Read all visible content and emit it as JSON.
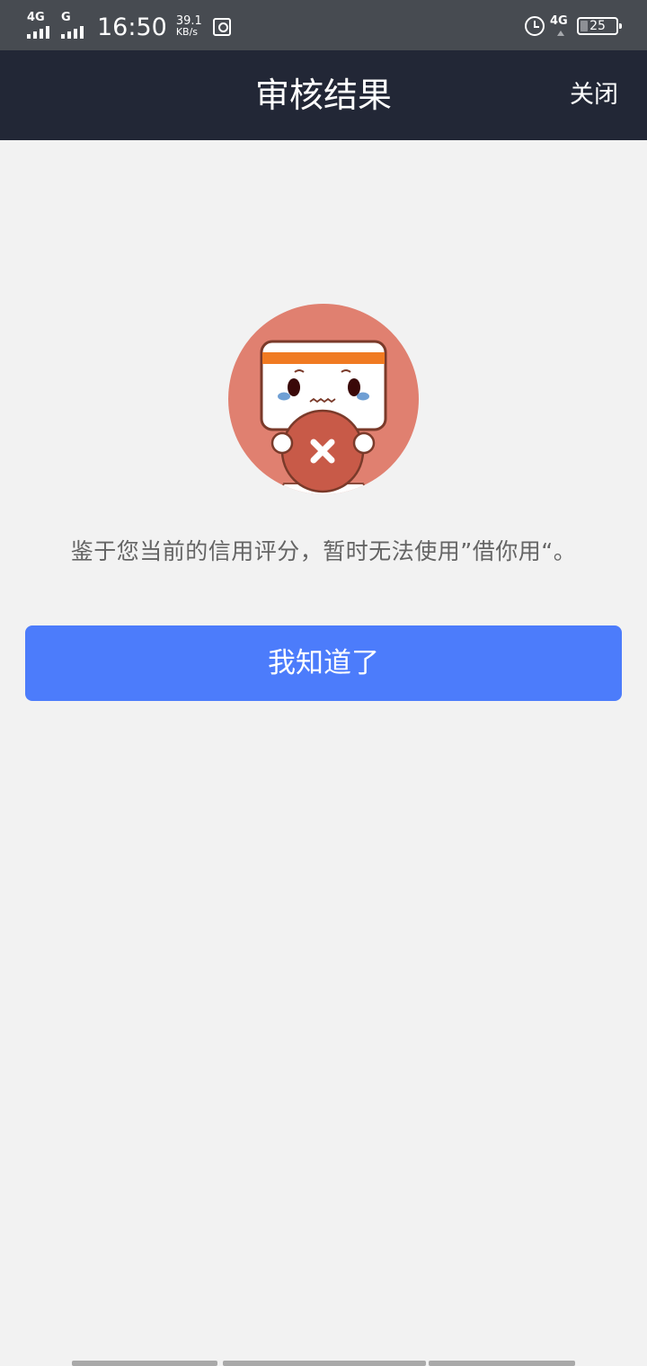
{
  "status_bar": {
    "network_left_1": "4G",
    "network_left_2": "G",
    "time": "16:50",
    "speed_value": "39.1",
    "speed_unit": "KB/s",
    "network_right": "4G",
    "battery": "25",
    "icons": [
      "signal-icon",
      "signal-icon",
      "screenshot-icon",
      "alarm-icon",
      "network-icon",
      "battery-icon"
    ]
  },
  "nav": {
    "title": "审核结果",
    "close_label": "关闭"
  },
  "illustration": {
    "icon": "rejected-mascot-icon",
    "circle_color": "#e08070",
    "badge_color": "#c85a48"
  },
  "main": {
    "message": "鉴于您当前的信用评分，暂时无法使用”借你用“。",
    "button_label": "我知道了",
    "button_color": "#4c7cfb"
  },
  "colors": {
    "nav_background": "#222736",
    "status_background": "#474b51",
    "page_background": "#f2f2f2"
  }
}
